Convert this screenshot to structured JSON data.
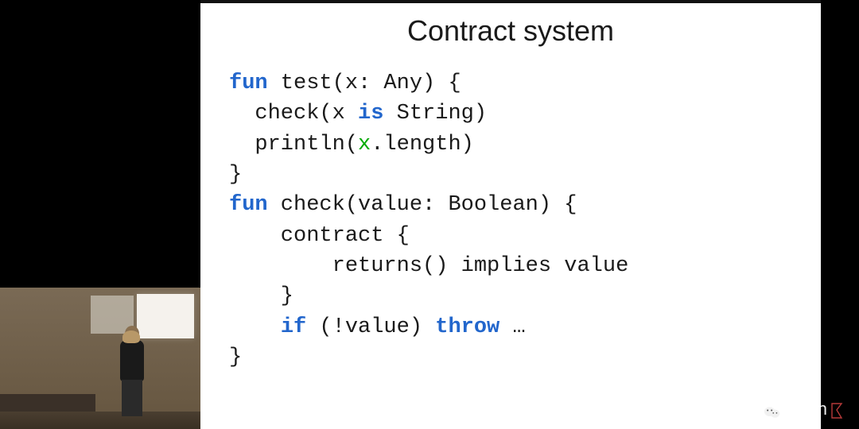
{
  "slide": {
    "title": "Contract system",
    "code": {
      "l1a": "fun",
      "l1b": " test(x: Any) {",
      "l2a": "  check(x ",
      "l2b": "is",
      "l2c": " String)",
      "l3a": "  println(",
      "l3b": "x",
      "l3c": ".length)",
      "l4": "}",
      "l5": "",
      "l6a": "fun",
      "l6b": " check(value: Boolean) {",
      "l7": "    contract {",
      "l8": "        returns() implies value",
      "l9": "    }",
      "l10a": "    ",
      "l10b": "if",
      "l10c": " (!value) ",
      "l10d": "throw",
      "l10e": " …",
      "l11": "}"
    }
  },
  "watermark": {
    "text": "Kotlin"
  }
}
